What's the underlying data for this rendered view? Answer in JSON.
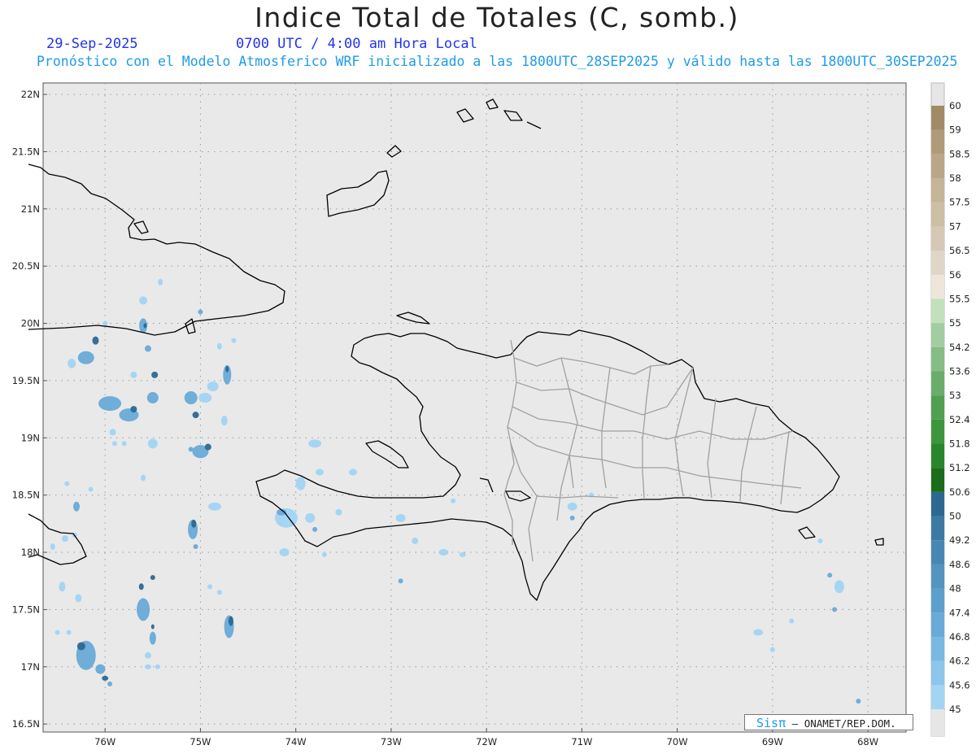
{
  "header": {
    "title": "Indice Total de Totales (C, somb.)",
    "date": "29-Sep-2025",
    "time": "0700 UTC / 4:00 am Hora Local",
    "description": "Pronóstico con el Modelo Atmosferico WRF inicializado a las 1800UTC_28SEP2025 y válido hasta las  1800UTC_30SEP2025"
  },
  "axes": {
    "lat_labels": [
      "22N",
      "21.5N",
      "21N",
      "20.5N",
      "20N",
      "19.5N",
      "19N",
      "18.5N",
      "18N",
      "17.5N",
      "17N",
      "16.5N"
    ],
    "lon_labels": [
      "76W",
      "75W",
      "74W",
      "73W",
      "72W",
      "71W",
      "70W",
      "69W",
      "68W"
    ],
    "lat_range": [
      16.43,
      22.1
    ],
    "lon_range": [
      -76.65,
      -67.6
    ],
    "grid": true
  },
  "legend": {
    "labels": [
      "45",
      "45.6",
      "46.2",
      "46.8",
      "47.4",
      "48",
      "48.6",
      "49.2",
      "50",
      "50.6",
      "51.2",
      "51.8",
      "52.4",
      "53",
      "53.6",
      "54.2",
      "55",
      "55.5",
      "56",
      "56.5",
      "57",
      "57.5",
      "58",
      "58.5",
      "59",
      "60"
    ],
    "colors": [
      "#a2d4f4",
      "#8cc6ec",
      "#79b8e2",
      "#69aad8",
      "#5d9fcc",
      "#5394c0",
      "#4887b3",
      "#3c7aa4",
      "#2d6892",
      "#1b6d1b",
      "#2a862a",
      "#3d963d",
      "#519f51",
      "#6aad6a",
      "#85bd85",
      "#a2cda2",
      "#c2e0bc",
      "#ede6d9",
      "#e0d6c7",
      "#d5c8b4",
      "#cdbea6",
      "#c4b498",
      "#baa787",
      "#af9b78",
      "#a18b66",
      "#947f5a"
    ]
  },
  "credit": {
    "brand": "Sisπ",
    "org": "– ONAMET/REP.DOM."
  },
  "colors": {
    "map_bg": "#e9e9e9",
    "coast": "#000000",
    "province_border": "#a0a0a0",
    "cell_light": "#a2d4f4",
    "cell_mid": "#69aad8",
    "cell_dark": "#2d6892"
  }
}
